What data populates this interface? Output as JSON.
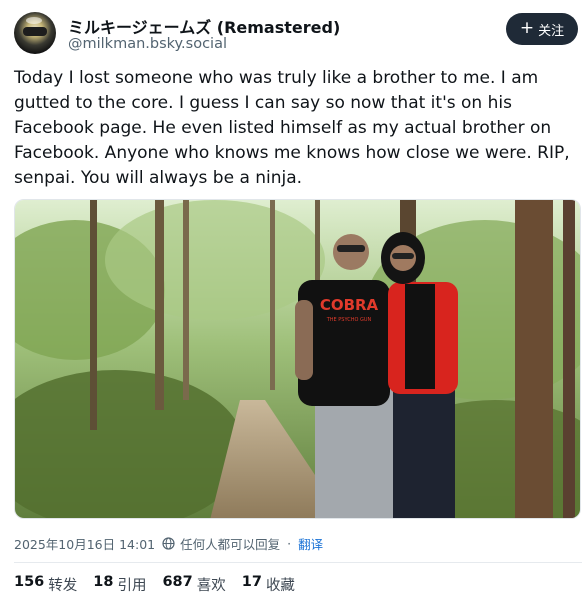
{
  "post": {
    "author": {
      "display_name": "ミルキージェームズ (Remastered)",
      "handle": "@milkman.bsky.social",
      "avatar_icon": "ninja-mask-avatar"
    },
    "follow_button": {
      "label": "关注",
      "icon": "plus-icon"
    },
    "text": "Today I lost someone who was truly like a brother to me. I am gutted to the core. I guess I can say so now that it's on his Facebook page. He even listed himself as my actual brother on Facebook. Anyone who knows me knows how close we were. RIP, senpai. You will always be a ninja.",
    "image": {
      "shirt_text_line1": "COBRA",
      "shirt_text_line2": "THE PSYCHO GUN"
    },
    "meta": {
      "timestamp": "2025年10月16日 14:01",
      "visibility": "任何人都可以回复",
      "separator": "·",
      "translate": "翻译"
    },
    "stats": [
      {
        "count": "156",
        "label": "转发"
      },
      {
        "count": "18",
        "label": "引用"
      },
      {
        "count": "687",
        "label": "喜欢"
      },
      {
        "count": "17",
        "label": "收藏"
      }
    ]
  },
  "colors": {
    "follow_bg": "#1f2a37",
    "link": "#1d74d6",
    "muted": "#536471"
  }
}
